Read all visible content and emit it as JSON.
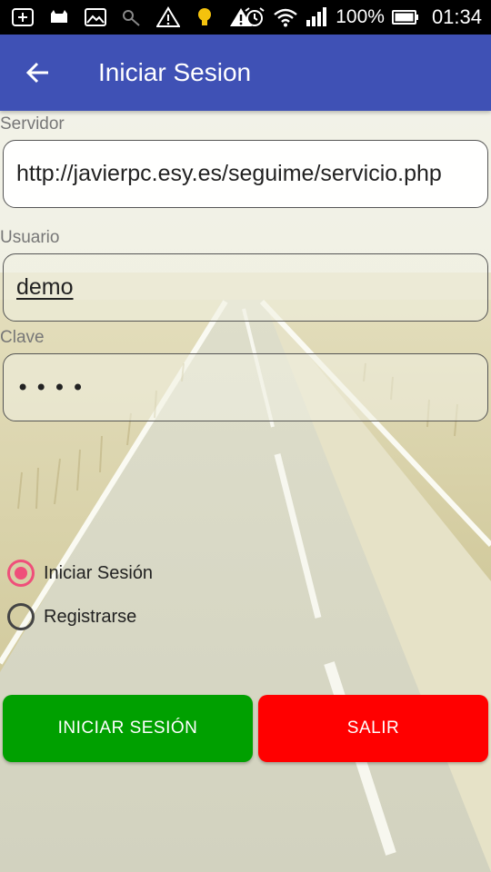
{
  "status_bar": {
    "battery": "100%",
    "time": "01:34",
    "left_icons": [
      "add-box-icon",
      "cat-icon",
      "image-icon",
      "key-icon",
      "warning-icon",
      "bulb-icon",
      "warning-icon"
    ],
    "right_icons": [
      "alarm-icon",
      "wifi-icon",
      "signal-icon",
      "battery-icon"
    ]
  },
  "app_bar": {
    "title": "Iniciar Sesion",
    "color": "#3f51b5"
  },
  "form": {
    "server_label": "Servidor",
    "server_value": "http://javierpc.esy.es/seguime/servicio.php",
    "user_label": "Usuario",
    "user_value": "demo",
    "password_label": "Clave",
    "password_value": "••••"
  },
  "mode": {
    "options": [
      {
        "label": "Iniciar Sesión",
        "selected": true
      },
      {
        "label": "Registrarse",
        "selected": false
      }
    ],
    "accent": "#ef4f7a"
  },
  "buttons": {
    "login_label": "INICIAR SESIÓN",
    "login_color": "#00a000",
    "exit_label": "SALIR",
    "exit_color": "#ff0000"
  }
}
